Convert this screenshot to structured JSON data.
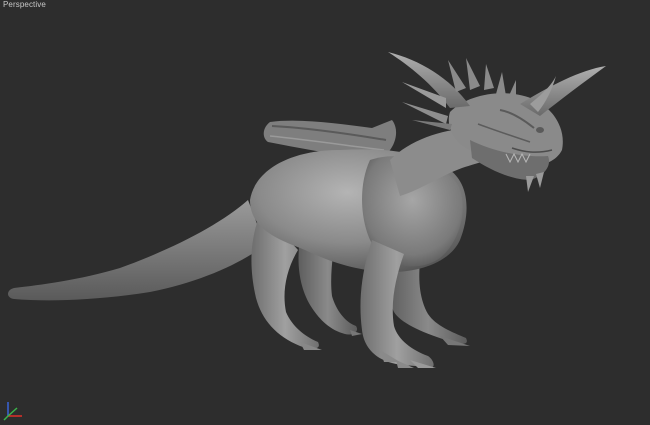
{
  "viewport": {
    "label": "Perspective",
    "model": "dragon-model",
    "gizmo": "axis-tripod-icon"
  },
  "colors": {
    "background": "#2d2d2d",
    "label": "#c8c8c8",
    "axis_x": "#e0302a",
    "axis_y": "#3bb54a",
    "axis_z": "#3a64d8"
  }
}
